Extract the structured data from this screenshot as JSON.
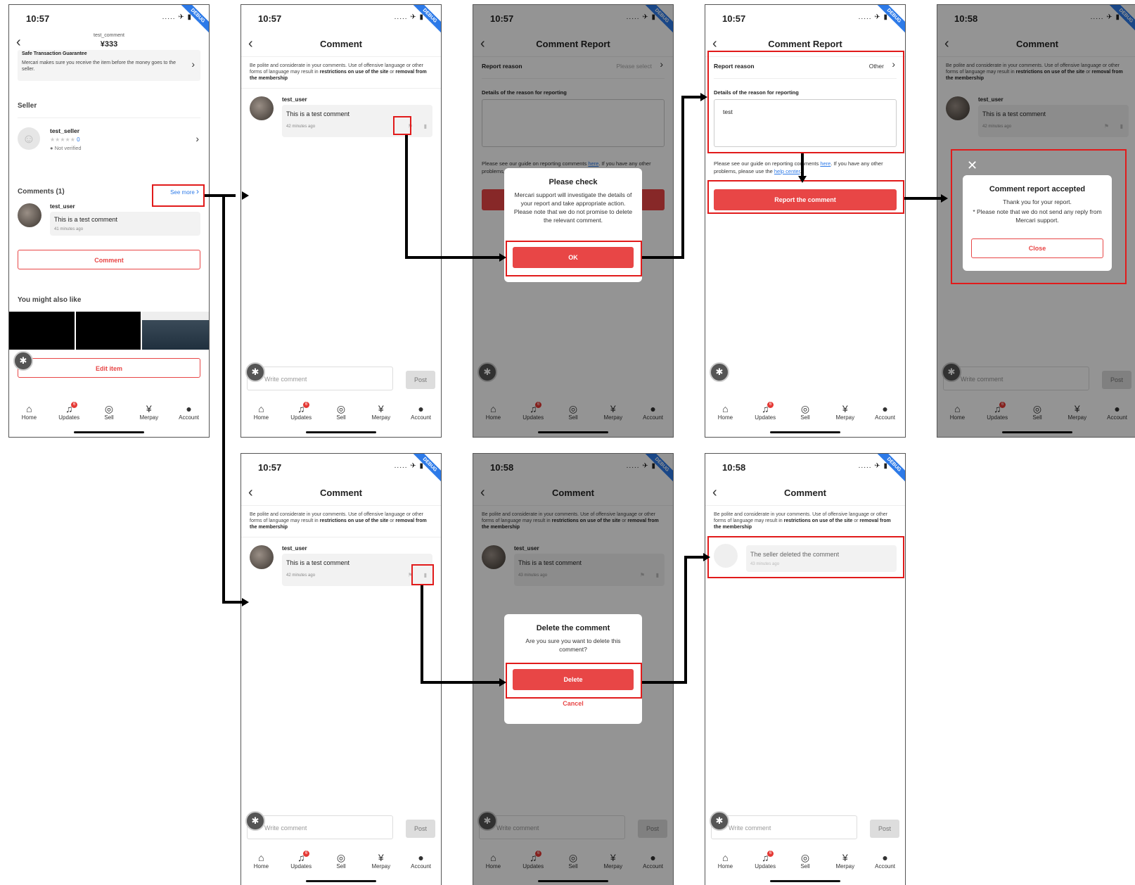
{
  "status": {
    "t1": "10:57",
    "t2": "10:58",
    "icons": "..... ✈ ▮",
    "debug": "DEBUG"
  },
  "nav": {
    "home": "Home",
    "updates": "Updates",
    "sell": "Sell",
    "merpay": "Merpay",
    "account": "Account",
    "badge": "6"
  },
  "common": {
    "comment_title": "Comment",
    "report_title": "Comment Report",
    "notice_a": "Be polite and considerate in your comments. Use of offensive language or other forms of language may result in ",
    "notice_b": "restrictions on use of the site",
    "notice_c": " or ",
    "notice_d": "removal from the membership",
    "notice_e": ".",
    "user": "test_user",
    "comment": "This is a test comment",
    "placeholder": "Write comment",
    "post": "Post",
    "bug_icon": "bug-icon"
  },
  "item": {
    "header_small": "test_comment",
    "price": "¥333",
    "safe_title": "Safe Transaction Guarantee",
    "safe_body": "Mercari makes sure you receive the item before the money goes to the seller.",
    "seller_heading": "Seller",
    "seller_name": "test_seller",
    "rating_count": "0",
    "verified": "Not verified",
    "comments_heading": "Comments (1)",
    "see_more": "See more",
    "ago": "41 minutes ago",
    "comment_btn": "Comment",
    "also_like": "You might also like",
    "edit_btn": "Edit item"
  },
  "ago": {
    "a42": "42 minutes ago",
    "a43": "43 minutes ago"
  },
  "report": {
    "reason_label": "Report reason",
    "please_select": "Please select",
    "other": "Other",
    "details_label": "Details of the reason for reporting",
    "details_value": "test",
    "guide_a": "Please see our guide on reporting comments ",
    "guide_here": "here",
    "guide_b": ". If you have any other problems, please use the ",
    "guide_help": "help center",
    "guide_c": ".",
    "submit": "Report the comment"
  },
  "check_dialog": {
    "title": "Please check",
    "body": "Mercari support will investigate the details of your report and take appropriate action. Please note that we do not promise to delete the relevant comment.",
    "ok": "OK"
  },
  "accepted_dialog": {
    "title": "Comment report accepted",
    "line1": "Thank you for your report.",
    "line2": "* Please note that we do not send any reply from Mercari support.",
    "close": "Close"
  },
  "delete_dialog": {
    "title": "Delete the comment",
    "body": "Are you sure you want to delete this comment?",
    "delete": "Delete",
    "cancel": "Cancel"
  },
  "deleted": {
    "text": "The seller deleted the comment"
  }
}
